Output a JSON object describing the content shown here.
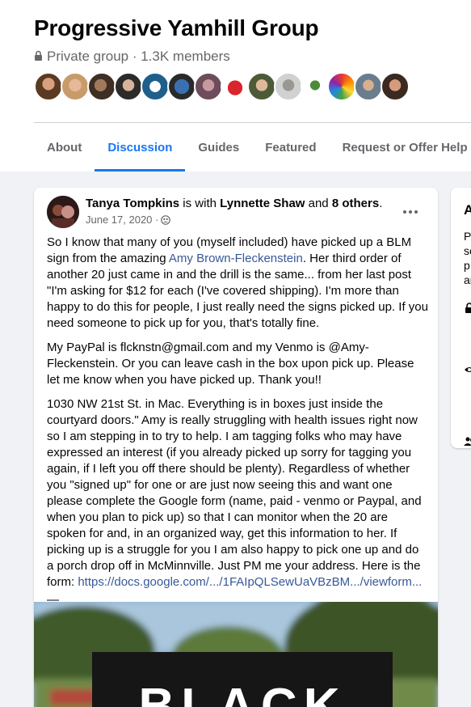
{
  "group": {
    "name": "Progressive Yamhill Group",
    "meta": "Private group · 1.3K members",
    "lock_icon": "lock-icon"
  },
  "tabs": [
    {
      "label": "About",
      "active": false
    },
    {
      "label": "Discussion",
      "active": true
    },
    {
      "label": "Guides",
      "active": false
    },
    {
      "label": "Featured",
      "active": false
    },
    {
      "label": "Request or Offer Help",
      "active": false
    }
  ],
  "post": {
    "author": "Tanya Tompkins",
    "with_text": " is with ",
    "tagged": "Lynnette Shaw",
    "and_text": " and ",
    "others": "8 others",
    "period": ".",
    "date": "June 17, 2020 · ",
    "privacy_icon": "group-audience-icon",
    "p1_a": "So I know that many of you (myself included) have picked up a BLM sign from the amazing ",
    "p1_link": "Amy Brown-Fleckenstein",
    "p1_b": ". Her third order of another 20 just came in and the drill is the same... from her last post \"I'm asking for $12 for each (I've covered shipping). I'm more than happy to do this for people, I just really need the signs picked up. If you need someone to pick up for you, that's totally fine.",
    "p2": "My PayPal is flcknstn@gmail.com and my Venmo is @Amy-Fleckenstein. Or you can leave cash in the box upon pick up. Please let me know when you have picked up. Thank you!!",
    "p3_a": "1030 NW 21st St. in Mac. Everything is in boxes just inside the courtyard doors.\" Amy is really struggling with health issues right now so I am stepping in to try to help. I am tagging folks who may have expressed an interest (if you already picked up sorry for tagging you again, if I left you off there should be plenty). Regardless of whether you \"signed up\" for one or are just now seeing this and want one please complete the Google form (name, paid - venmo or Paypal, and when you plan to pick up) so that I can monitor when the 20 are spoken for and, in an organized way, get this information to her. If picking up is a struggle for you I am also happy to pick one up and do a porch drop off in McMinnville. Just PM me your address. Here is the form: ",
    "p3_link": "https://docs.google.com/.../1FAIpQLSewUaVBzBM.../viewform...",
    "dash": "—",
    "image_text": "BLACK"
  },
  "side": {
    "title": "A",
    "lines": [
      "P",
      "se",
      "p",
      "ar"
    ]
  },
  "colors": {
    "accent": "#1877f2",
    "link": "#385898",
    "muted": "#65676b",
    "background": "#f0f2f5"
  }
}
